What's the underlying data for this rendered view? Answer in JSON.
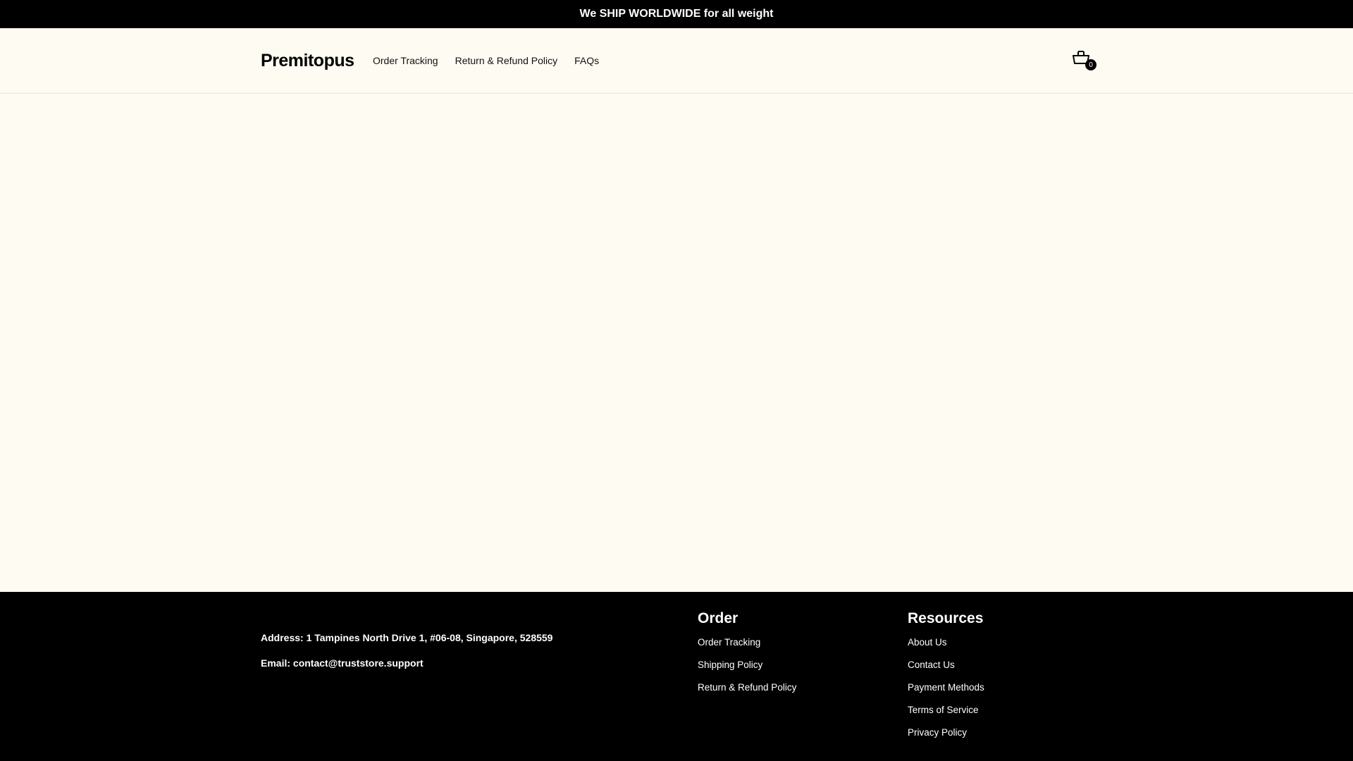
{
  "announcement": "We SHIP WORLDWIDE for all weight",
  "header": {
    "logo": "Premitopus",
    "nav": [
      "Order Tracking",
      "Return & Refund Policy",
      "FAQs"
    ],
    "cart_count": "0"
  },
  "footer": {
    "address": "Address: 1 Tampines North Drive 1, #06-08, Singapore, 528559",
    "email": "Email: contact@truststore.support",
    "order": {
      "title": "Order",
      "links": [
        "Order Tracking",
        "Shipping Policy",
        "Return & Refund Policy"
      ]
    },
    "resources": {
      "title": "Resources",
      "links": [
        "About Us",
        "Contact Us",
        "Payment Methods",
        "Terms of Service",
        "Privacy Policy"
      ]
    }
  }
}
